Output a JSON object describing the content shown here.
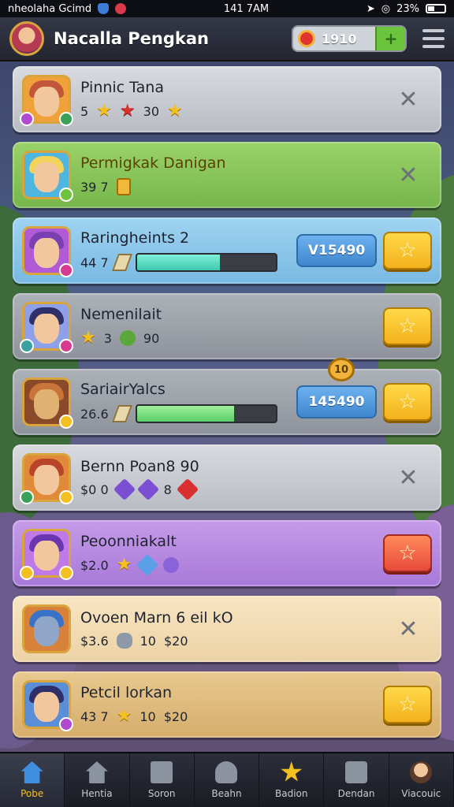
{
  "status_bar": {
    "left_text": "nheolaha Gcimd",
    "time": "141 7AM",
    "battery": "23%"
  },
  "header": {
    "title": "Nacalla Pengkan",
    "currency_amount": "1910",
    "plus_label": "+"
  },
  "cards": [
    {
      "name": "Pinnic Tana",
      "stats": [
        "5",
        "30"
      ]
    },
    {
      "name": "Permigkak Danigan",
      "stats": [
        "39 7"
      ]
    },
    {
      "name": "Raringheints 2",
      "stats": [
        "44 7"
      ],
      "progress": 0.6,
      "pill": "V15490"
    },
    {
      "name": "Nemenilait",
      "stats": [
        "3",
        "90"
      ]
    },
    {
      "name": "SariairYalcs",
      "stats": [
        "26.6"
      ],
      "progress": 0.7,
      "pill": "145490",
      "coin": "10"
    },
    {
      "name": "Bernn Poan8 90",
      "stats": [
        "$0 0",
        "8"
      ]
    },
    {
      "name": "Peoonniakalt",
      "stats": [
        "$2.0"
      ]
    },
    {
      "name": "Ovoen Marn 6 eil kO",
      "stats": [
        "$3.6",
        "10",
        "$20"
      ]
    },
    {
      "name": "Petcil lorkan",
      "stats": [
        "43 7",
        "10",
        "$20"
      ]
    }
  ],
  "nav": [
    {
      "label": "Pobe",
      "icon": "home-icon",
      "active": true
    },
    {
      "label": "Hentia",
      "icon": "house-icon",
      "active": false
    },
    {
      "label": "Soron",
      "icon": "document-icon",
      "active": false
    },
    {
      "label": "Beahn",
      "icon": "robot-icon",
      "active": false
    },
    {
      "label": "Badion",
      "icon": "star-icon",
      "active": false
    },
    {
      "label": "Dendan",
      "icon": "chest-icon",
      "active": false
    },
    {
      "label": "Viacouic",
      "icon": "avatar-icon",
      "active": false
    }
  ],
  "colors": {
    "accent_gold": "#f4c020",
    "action_red": "#e84a3a",
    "pill_blue": "#3f86cd"
  }
}
